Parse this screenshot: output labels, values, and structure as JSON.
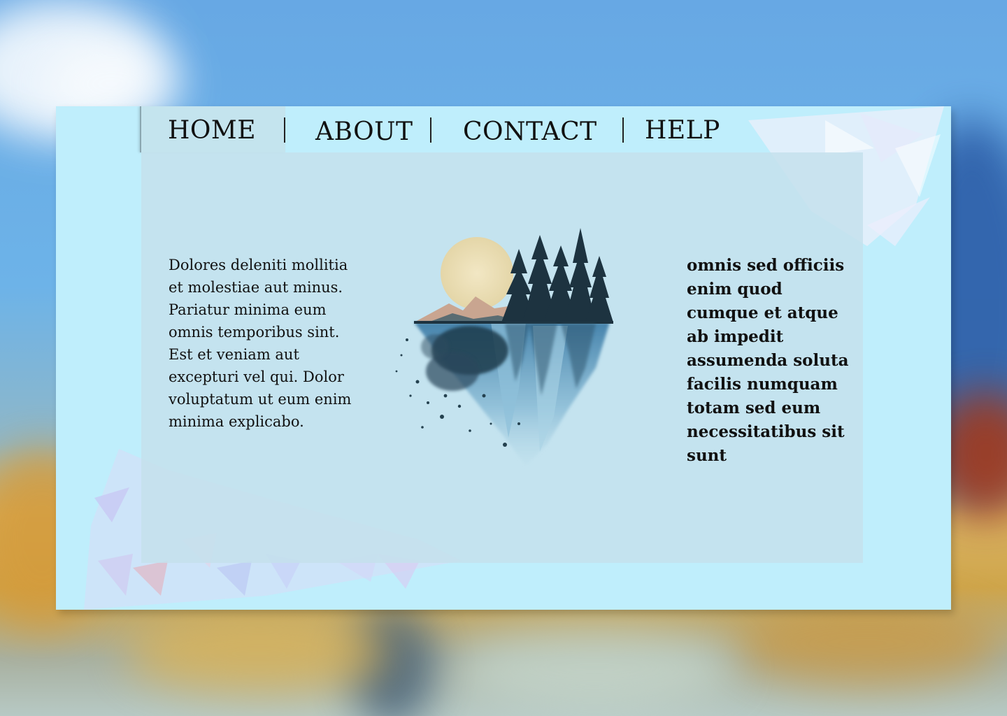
{
  "nav": {
    "items": [
      {
        "label": "HOME"
      },
      {
        "label": "ABOUT"
      },
      {
        "label": "CONTACT"
      },
      {
        "label": "HELP"
      }
    ]
  },
  "content": {
    "left_text": "Dolores deleniti mollitia et molestiae aut minus. Pariatur minima eum omnis temporibus sint. Est et veniam aut excepturi vel qui. Dolor voluptatum ut eum enim minima explicabo.",
    "right_text": "omnis sed officiis enim quod cumque et atque ab impedit assumenda soluta facilis numquam totam sed eum necessitatibus sit sunt"
  },
  "colors": {
    "card_background": "#bfeefc",
    "panel_background": "#c4e0ec",
    "text": "#111111"
  },
  "icons": {
    "illustration": "watercolor-forest-moon-illustration"
  }
}
